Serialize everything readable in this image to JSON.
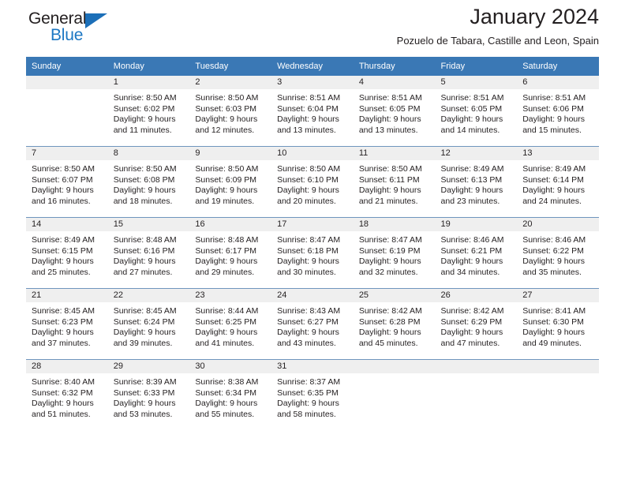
{
  "brand": {
    "name_top": "General",
    "name_bottom": "Blue",
    "accent_color": "#1c77c3",
    "triangle_color": "#1c6fb8"
  },
  "header": {
    "title": "January 2024",
    "location": "Pozuelo de Tabara, Castille and Leon, Spain"
  },
  "calendar": {
    "header_bg": "#3a78b5",
    "daynum_bg": "#efefef",
    "grid_line": "#6f95bd",
    "weekday_headers": [
      "Sunday",
      "Monday",
      "Tuesday",
      "Wednesday",
      "Thursday",
      "Friday",
      "Saturday"
    ],
    "weeks": [
      [
        {
          "day": "",
          "lines": []
        },
        {
          "day": "1",
          "lines": [
            "Sunrise: 8:50 AM",
            "Sunset: 6:02 PM",
            "Daylight: 9 hours",
            "and 11 minutes."
          ]
        },
        {
          "day": "2",
          "lines": [
            "Sunrise: 8:50 AM",
            "Sunset: 6:03 PM",
            "Daylight: 9 hours",
            "and 12 minutes."
          ]
        },
        {
          "day": "3",
          "lines": [
            "Sunrise: 8:51 AM",
            "Sunset: 6:04 PM",
            "Daylight: 9 hours",
            "and 13 minutes."
          ]
        },
        {
          "day": "4",
          "lines": [
            "Sunrise: 8:51 AM",
            "Sunset: 6:05 PM",
            "Daylight: 9 hours",
            "and 13 minutes."
          ]
        },
        {
          "day": "5",
          "lines": [
            "Sunrise: 8:51 AM",
            "Sunset: 6:05 PM",
            "Daylight: 9 hours",
            "and 14 minutes."
          ]
        },
        {
          "day": "6",
          "lines": [
            "Sunrise: 8:51 AM",
            "Sunset: 6:06 PM",
            "Daylight: 9 hours",
            "and 15 minutes."
          ]
        }
      ],
      [
        {
          "day": "7",
          "lines": [
            "Sunrise: 8:50 AM",
            "Sunset: 6:07 PM",
            "Daylight: 9 hours",
            "and 16 minutes."
          ]
        },
        {
          "day": "8",
          "lines": [
            "Sunrise: 8:50 AM",
            "Sunset: 6:08 PM",
            "Daylight: 9 hours",
            "and 18 minutes."
          ]
        },
        {
          "day": "9",
          "lines": [
            "Sunrise: 8:50 AM",
            "Sunset: 6:09 PM",
            "Daylight: 9 hours",
            "and 19 minutes."
          ]
        },
        {
          "day": "10",
          "lines": [
            "Sunrise: 8:50 AM",
            "Sunset: 6:10 PM",
            "Daylight: 9 hours",
            "and 20 minutes."
          ]
        },
        {
          "day": "11",
          "lines": [
            "Sunrise: 8:50 AM",
            "Sunset: 6:11 PM",
            "Daylight: 9 hours",
            "and 21 minutes."
          ]
        },
        {
          "day": "12",
          "lines": [
            "Sunrise: 8:49 AM",
            "Sunset: 6:13 PM",
            "Daylight: 9 hours",
            "and 23 minutes."
          ]
        },
        {
          "day": "13",
          "lines": [
            "Sunrise: 8:49 AM",
            "Sunset: 6:14 PM",
            "Daylight: 9 hours",
            "and 24 minutes."
          ]
        }
      ],
      [
        {
          "day": "14",
          "lines": [
            "Sunrise: 8:49 AM",
            "Sunset: 6:15 PM",
            "Daylight: 9 hours",
            "and 25 minutes."
          ]
        },
        {
          "day": "15",
          "lines": [
            "Sunrise: 8:48 AM",
            "Sunset: 6:16 PM",
            "Daylight: 9 hours",
            "and 27 minutes."
          ]
        },
        {
          "day": "16",
          "lines": [
            "Sunrise: 8:48 AM",
            "Sunset: 6:17 PM",
            "Daylight: 9 hours",
            "and 29 minutes."
          ]
        },
        {
          "day": "17",
          "lines": [
            "Sunrise: 8:47 AM",
            "Sunset: 6:18 PM",
            "Daylight: 9 hours",
            "and 30 minutes."
          ]
        },
        {
          "day": "18",
          "lines": [
            "Sunrise: 8:47 AM",
            "Sunset: 6:19 PM",
            "Daylight: 9 hours",
            "and 32 minutes."
          ]
        },
        {
          "day": "19",
          "lines": [
            "Sunrise: 8:46 AM",
            "Sunset: 6:21 PM",
            "Daylight: 9 hours",
            "and 34 minutes."
          ]
        },
        {
          "day": "20",
          "lines": [
            "Sunrise: 8:46 AM",
            "Sunset: 6:22 PM",
            "Daylight: 9 hours",
            "and 35 minutes."
          ]
        }
      ],
      [
        {
          "day": "21",
          "lines": [
            "Sunrise: 8:45 AM",
            "Sunset: 6:23 PM",
            "Daylight: 9 hours",
            "and 37 minutes."
          ]
        },
        {
          "day": "22",
          "lines": [
            "Sunrise: 8:45 AM",
            "Sunset: 6:24 PM",
            "Daylight: 9 hours",
            "and 39 minutes."
          ]
        },
        {
          "day": "23",
          "lines": [
            "Sunrise: 8:44 AM",
            "Sunset: 6:25 PM",
            "Daylight: 9 hours",
            "and 41 minutes."
          ]
        },
        {
          "day": "24",
          "lines": [
            "Sunrise: 8:43 AM",
            "Sunset: 6:27 PM",
            "Daylight: 9 hours",
            "and 43 minutes."
          ]
        },
        {
          "day": "25",
          "lines": [
            "Sunrise: 8:42 AM",
            "Sunset: 6:28 PM",
            "Daylight: 9 hours",
            "and 45 minutes."
          ]
        },
        {
          "day": "26",
          "lines": [
            "Sunrise: 8:42 AM",
            "Sunset: 6:29 PM",
            "Daylight: 9 hours",
            "and 47 minutes."
          ]
        },
        {
          "day": "27",
          "lines": [
            "Sunrise: 8:41 AM",
            "Sunset: 6:30 PM",
            "Daylight: 9 hours",
            "and 49 minutes."
          ]
        }
      ],
      [
        {
          "day": "28",
          "lines": [
            "Sunrise: 8:40 AM",
            "Sunset: 6:32 PM",
            "Daylight: 9 hours",
            "and 51 minutes."
          ]
        },
        {
          "day": "29",
          "lines": [
            "Sunrise: 8:39 AM",
            "Sunset: 6:33 PM",
            "Daylight: 9 hours",
            "and 53 minutes."
          ]
        },
        {
          "day": "30",
          "lines": [
            "Sunrise: 8:38 AM",
            "Sunset: 6:34 PM",
            "Daylight: 9 hours",
            "and 55 minutes."
          ]
        },
        {
          "day": "31",
          "lines": [
            "Sunrise: 8:37 AM",
            "Sunset: 6:35 PM",
            "Daylight: 9 hours",
            "and 58 minutes."
          ]
        },
        {
          "day": "",
          "lines": []
        },
        {
          "day": "",
          "lines": []
        },
        {
          "day": "",
          "lines": []
        }
      ]
    ]
  }
}
